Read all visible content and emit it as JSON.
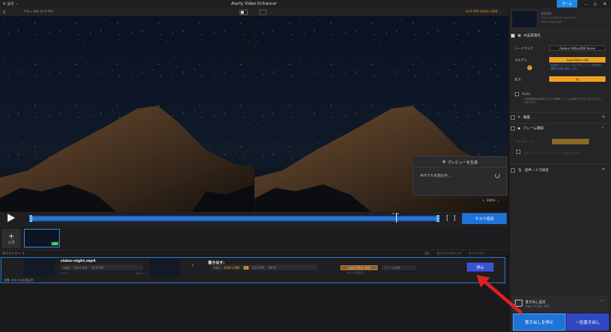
{
  "titlebar": {
    "app_title": "Aiarty Video Enhancer",
    "settings_label": "設定",
    "home_label": "ホーム"
  },
  "preview": {
    "left_info": "718 x 404  23.9 FPS",
    "right_info": "23.9 FPS  1436 x 808",
    "left_tag": "前",
    "popup_title": "プレビューを生成",
    "popup_status": "AIモデルを読込中...",
    "zoom": "100%"
  },
  "timeline": {
    "timecode": "00:06",
    "add_task_label": "タスク追加",
    "progress": 0.9
  },
  "clips": {
    "input_label": "入力"
  },
  "tasks": {
    "count_label": "タスクリスト: 1",
    "stop_all": "停止",
    "clear_completed": "完了タスクをクリア",
    "clear_all": "すべてクリア",
    "row": {
      "filename": "video-night.mp4",
      "src_container": "mp4",
      "src_res": "718 x 404",
      "src_fps": "23.9 FPS",
      "src_start": "00:00",
      "src_end": "00:07",
      "out_label": "書き出す:",
      "out_container": "mp4",
      "out_res": "1436 x 808",
      "out_scale": "x2",
      "out_fps": "23.9 FPS",
      "out_duration": "00:07",
      "model": "superVideo vHQ",
      "frame": "フレーム補間",
      "model_sub": "AIモデル読込中",
      "stop_label": "停止",
      "loading": "状態: AIモデルを読込中"
    }
  },
  "right_panel": {
    "file_info": [
      "動画情報",
      "718 x 404  00:07  mp4  23.9",
      "video-night.mp4"
    ],
    "ai_section": "AI品質強化",
    "hardware_label": "ハードウェア",
    "hardware_value": "Radeon RX6xx/560 Series",
    "model_label": "AIモデル",
    "model_value": "superVideo vHQ",
    "model_desc": "高品質モデルでノイズやブロックノイズを除去し細部を自然に補正します。",
    "scale_label": "拡大",
    "scale_value": "x2",
    "turbo_label": "Turbo",
    "turbo_desc": "AI処理速度を高速化しますが映像によっては品質がわずかに低下することがあります。",
    "edit_section": "編集",
    "frame_section": "フレーム補間",
    "frame_label": "フレームレート",
    "frame_sub": "スローモーション / フレームレートを自然に上げます",
    "noise_section": "音声ノイズ除去",
    "export_title": "書き出し設定",
    "export_sub": "mp4 / H.264, AAC",
    "stop_export": "書き出しを停止",
    "batch_export": "一括書き出し"
  },
  "colors": {
    "accent_blue": "#1e73d8",
    "accent_orange": "#f0a020",
    "annotation_red": "#e02020"
  }
}
